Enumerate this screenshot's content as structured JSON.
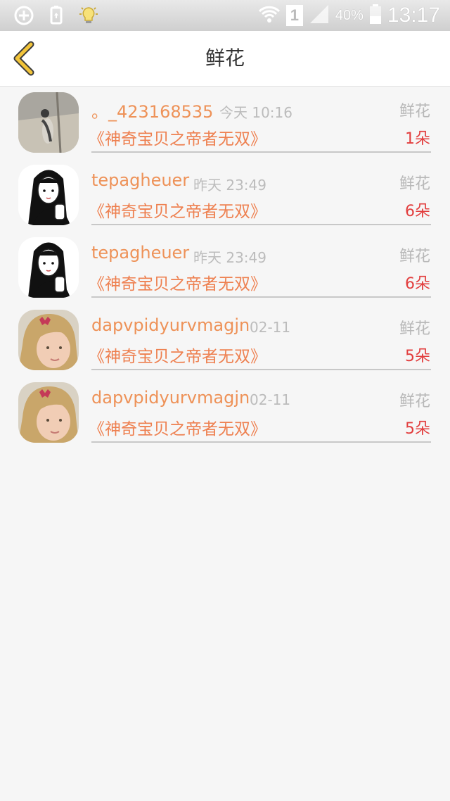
{
  "status_bar": {
    "battery_percent": "40%",
    "signal_badge": "1",
    "time": "13:17",
    "icons": [
      "add-circle-icon",
      "battery-saver-icon",
      "lightbulb-icon",
      "wifi-icon",
      "sim-icon",
      "signal-icon",
      "battery-icon"
    ]
  },
  "header": {
    "title": "鲜花",
    "back_icon": "chevron-left-icon",
    "accent_color": "#f2c43a"
  },
  "list": {
    "items": [
      {
        "name": "。_423168535",
        "time": "今天 10:16",
        "type": "鲜花",
        "book": "《神奇宝贝之帝者无双》",
        "count": "1朵",
        "avatar": "cat-photo"
      },
      {
        "name": "tepagheuer",
        "time": "昨天 23:49",
        "type": "鲜花",
        "book": "《神奇宝贝之帝者无双》",
        "count": "6朵",
        "avatar": "girl-sketch"
      },
      {
        "name": "tepagheuer",
        "time": "昨天 23:49",
        "type": "鲜花",
        "book": "《神奇宝贝之帝者无双》",
        "count": "6朵",
        "avatar": "girl-sketch"
      },
      {
        "name": "dapvpidyurvmagjn",
        "time": "02-11",
        "type": "鲜花",
        "book": "《神奇宝贝之帝者无双》",
        "count": "5朵",
        "avatar": "child-photo"
      },
      {
        "name": "dapvpidyurvmagjn",
        "time": "02-11",
        "type": "鲜花",
        "book": "《神奇宝贝之帝者无双》",
        "count": "5朵",
        "avatar": "child-photo"
      }
    ]
  },
  "colors": {
    "name": "#ee9258",
    "book": "#ee8050",
    "count": "#e23d3d",
    "meta": "#bcbcbc"
  }
}
